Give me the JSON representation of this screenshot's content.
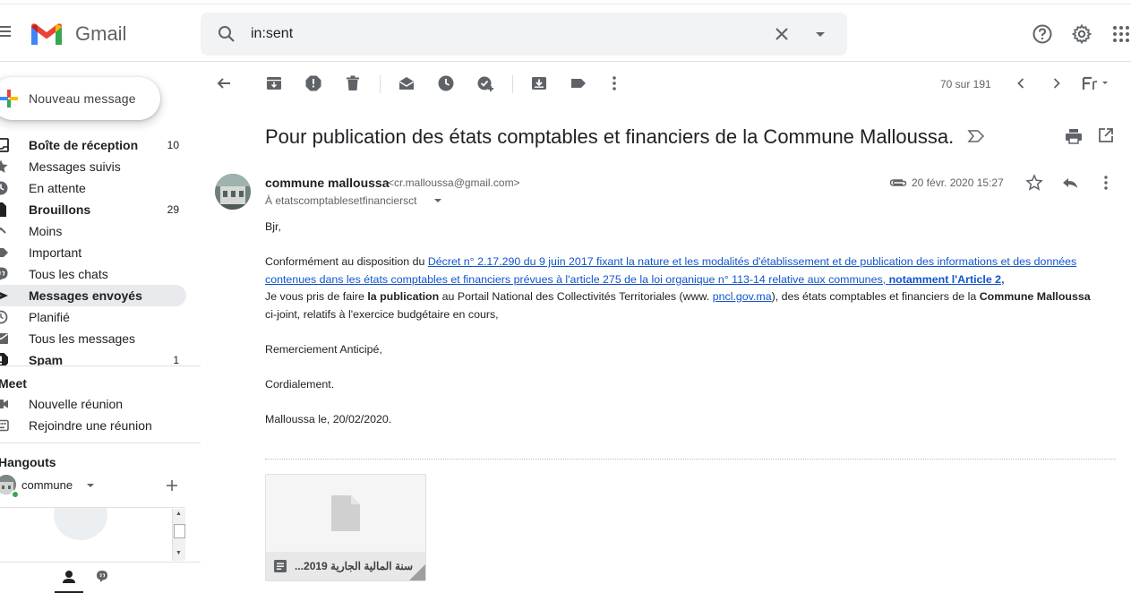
{
  "app": {
    "name": "Gmail"
  },
  "search": {
    "value": "in:sent"
  },
  "compose": {
    "label": "Nouveau message"
  },
  "sidebar": {
    "items": [
      {
        "label": "Boîte de réception",
        "count": "10",
        "bold": true
      },
      {
        "label": "Messages suivis",
        "count": ""
      },
      {
        "label": "En attente",
        "count": ""
      },
      {
        "label": "Brouillons",
        "count": "29",
        "bold": true
      },
      {
        "label": "Moins",
        "count": ""
      },
      {
        "label": "Important",
        "count": ""
      },
      {
        "label": "Tous les chats",
        "count": ""
      },
      {
        "label": "Messages envoyés",
        "count": "",
        "bold": true,
        "active": true
      },
      {
        "label": "Planifié",
        "count": ""
      },
      {
        "label": "Tous les messages",
        "count": ""
      },
      {
        "label": "Spam",
        "count": "1",
        "bold": true
      }
    ]
  },
  "meet": {
    "title": "Meet",
    "new_meeting": "Nouvelle réunion",
    "join_meeting": "Rejoindre une réunion"
  },
  "hangouts": {
    "title": "Hangouts",
    "user": "commune"
  },
  "toolbar": {
    "pager": "70 sur 191"
  },
  "message": {
    "subject": "Pour publication des états comptables et financiers de la Commune Malloussa.",
    "sender_name": "commune malloussa",
    "sender_email": "<cr.malloussa@gmail.com>",
    "to": "À etatscomptablesetfinanciersct",
    "date": "20 févr. 2020 15:27",
    "greeting": "Bjr,",
    "p1_prefix": "Conformément au disposition du ",
    "p1_link": "Décret n° 2.17.290  du 9 juin 2017 fixant la nature et les modalités d'établissement et de publication des informations et des données contenues dans les états comptables et financiers prévues à l'article 275 de la loi organique n° 113-14 relative aux communes, ",
    "p1_link_bold": "notamment l'Article 2,",
    "p2_a": "Je vous pris de faire ",
    "p2_bold1": "la publication",
    "p2_b": " au Portail National des Collectivités Territoriales (www. ",
    "p2_link": "pncl.gov.ma",
    "p2_c": "), des états comptables et financiers de la ",
    "p2_bold2": "Commune Malloussa",
    "p2_d": " ci-joint, relatifs à l'exercice budgétaire en cours,",
    "thanks": "Remerciement Anticipé,",
    "regards": "Cordialement.",
    "sign": "Malloussa le, 20/02/2020.",
    "attachment_name": "...سنة المالية الجارية 2019"
  }
}
